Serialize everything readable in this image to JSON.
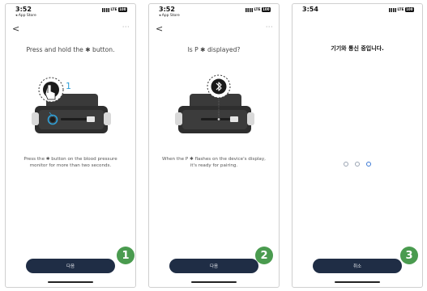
{
  "screens": [
    {
      "status": {
        "time": "3:52",
        "back_app": "◂ App Store",
        "network": "LTE",
        "battery": "100"
      },
      "nav": {
        "back": "<",
        "more": "···"
      },
      "title": "Press and hold the ✱ button.",
      "callout": "1",
      "description": "Press the ✱ button on the blood pressure monitor for more than two seconds.",
      "button": "다음",
      "step": "1"
    },
    {
      "status": {
        "time": "3:52",
        "back_app": "◂ App Store",
        "network": "LTE",
        "battery": "100"
      },
      "nav": {
        "back": "<",
        "more": "···"
      },
      "title": "Is P ✱ displayed?",
      "description": "When the P ✱ flashes on the device's display, it's ready for pairing.",
      "button": "다음",
      "step": "2"
    },
    {
      "status": {
        "time": "3:54",
        "network": "LTE",
        "battery": "100"
      },
      "title": "기기와 통신 중입니다.",
      "progress_dots": 3,
      "active_dot": 3,
      "button": "취소",
      "step": "3"
    }
  ],
  "colors": {
    "button": "#1f2d45",
    "badge": "#4a9b4f",
    "accent": "#2fa0d8",
    "active_dot": "#3a78d4"
  },
  "icons": [
    "bluetooth-icon",
    "hand-pointer-icon",
    "signal-icon",
    "battery-icon"
  ]
}
